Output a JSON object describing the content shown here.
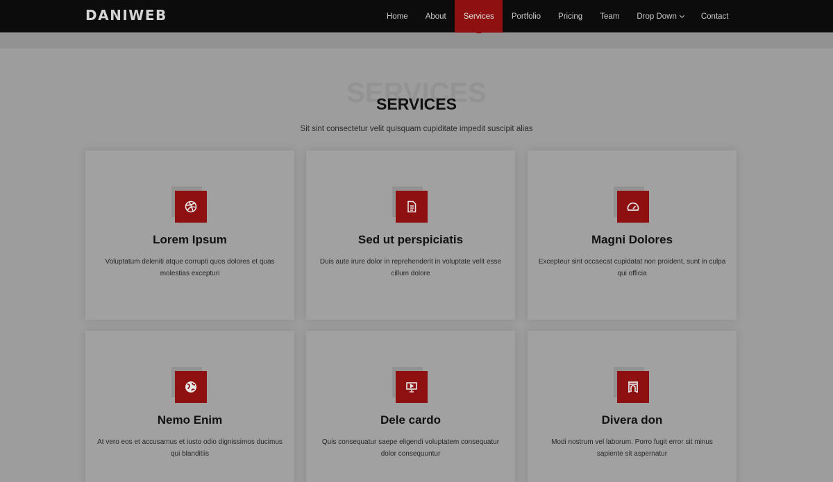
{
  "brand": {
    "logo": "DANIWEB"
  },
  "nav": {
    "items": [
      {
        "label": "Home"
      },
      {
        "label": "About"
      },
      {
        "label": "Services",
        "active": true
      },
      {
        "label": "Portfolio"
      },
      {
        "label": "Pricing"
      },
      {
        "label": "Team"
      },
      {
        "label": "Drop Down",
        "has_dropdown": true
      },
      {
        "label": "Contact"
      }
    ]
  },
  "section": {
    "ghost_title": "SERVICES",
    "title": "SERVICES",
    "subtitle": "Sit sint consectetur velit quisquam cupiditate impedit suscipit alias"
  },
  "services": [
    {
      "title": "Lorem Ipsum",
      "text": "Voluptatum deleniti atque corrupti quos dolores et quas molestias excepturi",
      "icon": "dribbble-icon"
    },
    {
      "title": "Sed ut perspiciatis",
      "text": "Duis aute irure dolor in reprehenderit in voluptate velit esse cillum dolore",
      "icon": "file-icon"
    },
    {
      "title": "Magni Dolores",
      "text": "Excepteur sint occaecat cupidatat non proident, sunt in culpa qui officia",
      "icon": "speedometer-icon"
    },
    {
      "title": "Nemo Enim",
      "text": "At vero eos et accusamus et iusto odio dignissimos ducimus qui blanditiis",
      "icon": "globe-icon"
    },
    {
      "title": "Dele cardo",
      "text": "Quis consequatur saepe eligendi voluptatem consequatur dolor consequuntur",
      "icon": "presentation-icon"
    },
    {
      "title": "Divera don",
      "text": "Modi nostrum vel laborum. Porro fugit error sit minus sapiente sit aspernatur",
      "icon": "arch-icon"
    }
  ],
  "colors": {
    "accent": "#8f1010",
    "header_bg": "#0c0c0c",
    "page_bg": "#9d9d9d",
    "card_bg": "#a1a1a1"
  }
}
